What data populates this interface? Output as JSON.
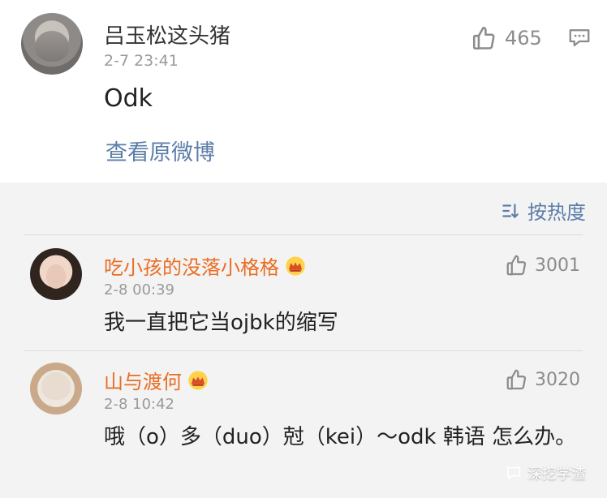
{
  "main_comment": {
    "username": "吕玉松这头猪",
    "timestamp": "2-7 23:41",
    "text": "Odk",
    "likes": "465",
    "view_original": "查看原微博"
  },
  "sort": {
    "label": "按热度"
  },
  "replies": [
    {
      "username": "吃小孩的没落小格格",
      "timestamp": "2-8 00:39",
      "text": "我一直把它当ojbk的缩写",
      "likes": "3001"
    },
    {
      "username": "山与渡何",
      "timestamp": "2-8 10:42",
      "text": "哦（o）多（duo）尅（kei）～odk 韩语 怎么办。",
      "likes": "3020"
    }
  ],
  "watermark": {
    "text": "深挖学渣"
  },
  "colors": {
    "link": "#5c7ea8",
    "name_accent": "#ea6d23",
    "meta": "#9a9a9a"
  }
}
